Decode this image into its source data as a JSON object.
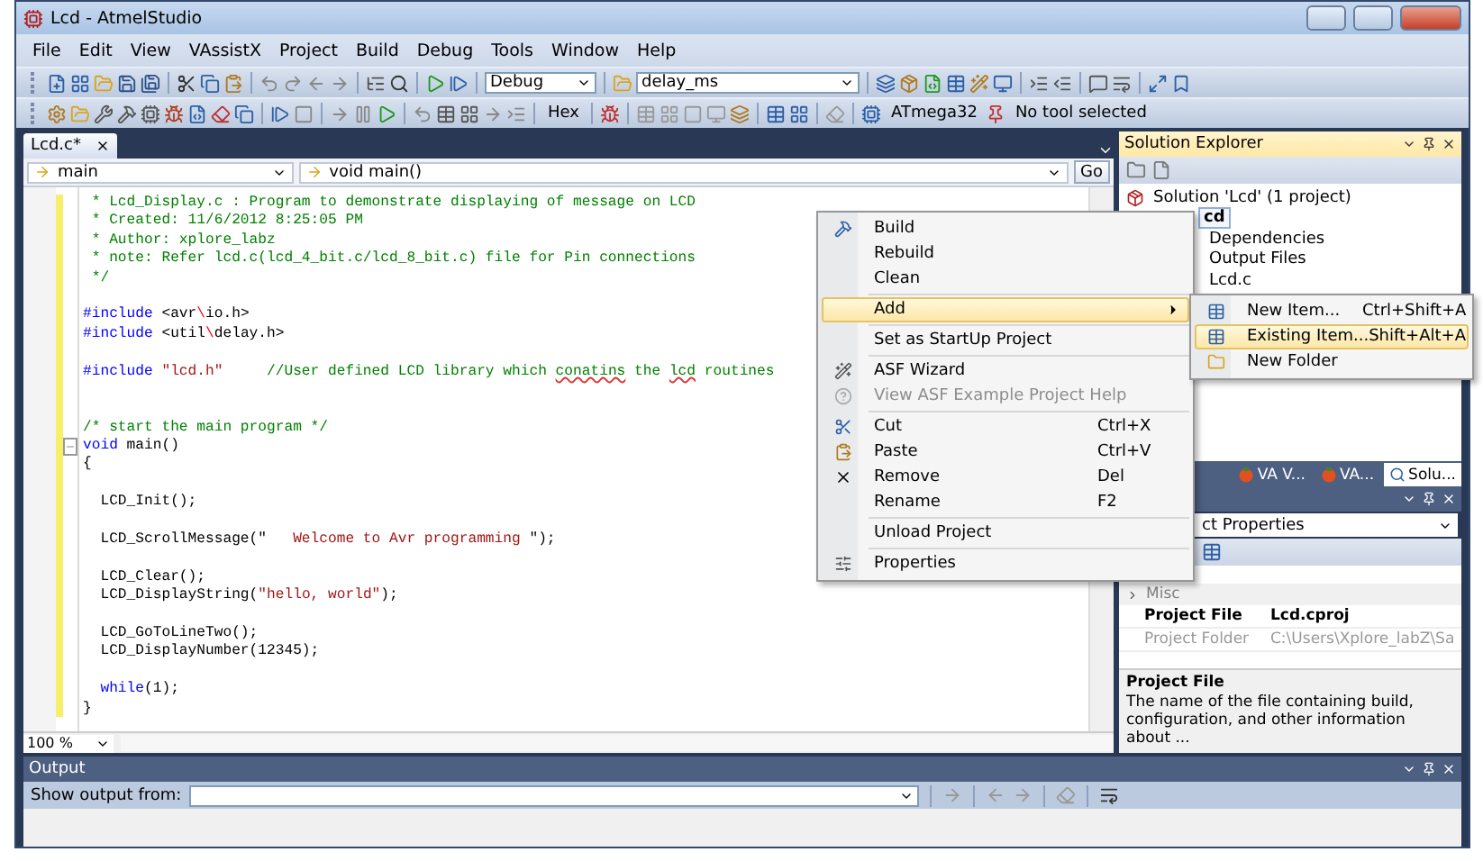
{
  "window": {
    "title": "Lcd - AtmelStudio"
  },
  "menu_bar": [
    "File",
    "Edit",
    "View",
    "VAssistX",
    "Project",
    "Build",
    "Debug",
    "Tools",
    "Window",
    "Help"
  ],
  "toolbar": {
    "configuration": "Debug",
    "function_search": "delay_ms",
    "hex_label": "Hex",
    "device": "ATmega32",
    "tool": "No tool selected"
  },
  "editor": {
    "tab": {
      "label": "Lcd.c*",
      "selected": true
    },
    "scope": "main",
    "member": "void main()",
    "go_button": "Go",
    "zoom": "100 %",
    "lines": [
      {
        "kind": "code",
        "tokens": [
          {
            "text": " * Lcd_Display.c : Program to demonstrate displaying of message on LCD",
            "kind": "comment"
          }
        ]
      },
      {
        "kind": "code",
        "tokens": [
          {
            "text": " * Created: 11/6/2012 8:25:05 PM",
            "kind": "comment"
          }
        ]
      },
      {
        "kind": "code",
        "tokens": [
          {
            "text": " * Author: xplore_labz",
            "kind": "comment"
          }
        ]
      },
      {
        "kind": "code",
        "tokens": [
          {
            "text": " * note: Refer lcd.c(lcd_4_bit.c/lcd_8_bit.c) file for Pin connections",
            "kind": "comment"
          }
        ]
      },
      {
        "kind": "code",
        "tokens": [
          {
            "text": " */",
            "kind": "comment"
          }
        ]
      },
      {
        "kind": "blank"
      },
      {
        "kind": "code",
        "tokens": [
          {
            "text": "#include",
            "kind": "keyword"
          },
          {
            "text": " <avr",
            "kind": "plain"
          },
          {
            "text": "\\",
            "kind": "escape"
          },
          {
            "text": "io.h>",
            "kind": "plain"
          }
        ]
      },
      {
        "kind": "code",
        "tokens": [
          {
            "text": "#include",
            "kind": "keyword"
          },
          {
            "text": " <util",
            "kind": "plain"
          },
          {
            "text": "\\",
            "kind": "escape"
          },
          {
            "text": "delay.h>",
            "kind": "plain"
          }
        ]
      },
      {
        "kind": "blank"
      },
      {
        "kind": "code",
        "tokens": [
          {
            "text": "#include",
            "kind": "keyword"
          },
          {
            "text": " \"lcd.h\"",
            "kind": "string"
          },
          {
            "text": "     //User defined LCD library which ",
            "kind": "comment"
          },
          {
            "text": "conatins",
            "kind": "misspelled"
          },
          {
            "text": " the ",
            "kind": "comment"
          },
          {
            "text": "lcd",
            "kind": "misspelled"
          },
          {
            "text": " routines",
            "kind": "comment"
          }
        ]
      },
      {
        "kind": "blank"
      },
      {
        "kind": "blank"
      },
      {
        "kind": "code",
        "tokens": [
          {
            "text": "/* start the main program */",
            "kind": "comment"
          }
        ]
      },
      {
        "kind": "code",
        "fold": true,
        "tokens": [
          {
            "text": "void",
            "kind": "keyword"
          },
          {
            "text": " main()",
            "kind": "plain"
          }
        ]
      },
      {
        "kind": "code",
        "tokens": [
          {
            "text": "{",
            "kind": "plain"
          }
        ]
      },
      {
        "kind": "blank"
      },
      {
        "kind": "code",
        "tokens": [
          {
            "text": "  LCD_Init();",
            "kind": "plain"
          }
        ]
      },
      {
        "kind": "blank"
      },
      {
        "kind": "code",
        "tokens": [
          {
            "text": "  LCD_ScrollMessage(\"",
            "kind": "plain"
          },
          {
            "text": "   Welcome to Avr programming ",
            "kind": "string"
          },
          {
            "text": "\");",
            "kind": "plain"
          }
        ]
      },
      {
        "kind": "blank"
      },
      {
        "kind": "code",
        "tokens": [
          {
            "text": "  LCD_Clear();",
            "kind": "plain"
          }
        ]
      },
      {
        "kind": "code",
        "tokens": [
          {
            "text": "  LCD_DisplayString(",
            "kind": "plain"
          },
          {
            "text": "\"hello, world\"",
            "kind": "string"
          },
          {
            "text": ");",
            "kind": "plain"
          }
        ]
      },
      {
        "kind": "blank"
      },
      {
        "kind": "code",
        "tokens": [
          {
            "text": "  LCD_GoToLineTwo();",
            "kind": "plain"
          }
        ]
      },
      {
        "kind": "code",
        "tokens": [
          {
            "text": "  LCD_DisplayNumber(12345);",
            "kind": "plain"
          }
        ]
      },
      {
        "kind": "blank"
      },
      {
        "kind": "code",
        "tokens": [
          {
            "text": "  while",
            "kind": "keyword"
          },
          {
            "text": "(1);",
            "kind": "plain"
          }
        ]
      },
      {
        "kind": "code",
        "tokens": [
          {
            "text": "}",
            "kind": "plain"
          }
        ]
      }
    ]
  },
  "context_menu": {
    "items": [
      {
        "kind": "item",
        "label": "Build",
        "selected": false,
        "disabled": false
      },
      {
        "kind": "item",
        "label": "Rebuild",
        "selected": false,
        "disabled": false
      },
      {
        "kind": "item",
        "label": "Clean",
        "selected": false,
        "disabled": false
      },
      {
        "kind": "separator"
      },
      {
        "kind": "submenu",
        "label": "Add",
        "selected": true,
        "disabled": false
      },
      {
        "kind": "separator"
      },
      {
        "kind": "item",
        "label": "Set as StartUp Project",
        "selected": false,
        "disabled": false
      },
      {
        "kind": "separator"
      },
      {
        "kind": "item",
        "label": "ASF Wizard",
        "selected": false,
        "disabled": false
      },
      {
        "kind": "item",
        "label": "View ASF Example Project Help",
        "selected": false,
        "disabled": true
      },
      {
        "kind": "separator"
      },
      {
        "kind": "item",
        "label": "Cut",
        "shortcut": "Ctrl+X",
        "selected": false,
        "disabled": false
      },
      {
        "kind": "item",
        "label": "Paste",
        "shortcut": "Ctrl+V",
        "selected": false,
        "disabled": false
      },
      {
        "kind": "item",
        "label": "Remove",
        "shortcut": "Del",
        "selected": false,
        "disabled": false
      },
      {
        "kind": "item",
        "label": "Rename",
        "shortcut": "F2",
        "selected": false,
        "disabled": false
      },
      {
        "kind": "separator"
      },
      {
        "kind": "item",
        "label": "Unload Project",
        "selected": false,
        "disabled": false
      },
      {
        "kind": "separator"
      },
      {
        "kind": "item",
        "label": "Properties",
        "selected": false,
        "disabled": false
      }
    ]
  },
  "submenu": {
    "items": [
      {
        "label": "New Item...",
        "shortcut": "Ctrl+Shift+A",
        "selected": false
      },
      {
        "label": "Existing Item...",
        "shortcut": "Shift+Alt+A",
        "selected": true
      },
      {
        "label": "New Folder",
        "selected": false
      }
    ]
  },
  "solution_explorer": {
    "title": "Solution Explorer",
    "tree": {
      "label": "Solution 'Lcd' (1 project)",
      "selected": false,
      "children": [
        {
          "label": "cd",
          "selected": true,
          "children": [
            {
              "label": "Dependencies",
              "selected": false
            },
            {
              "label": "Output Files",
              "selected": false
            },
            {
              "label": "Lcd.c",
              "selected": false
            }
          ]
        }
      ]
    },
    "tabs": [
      {
        "label": "VA V...",
        "selected": false
      },
      {
        "label": "VA...",
        "selected": false
      },
      {
        "label": "Solu...",
        "selected": true
      }
    ]
  },
  "properties": {
    "object": "ct Properties",
    "category": "Misc",
    "rows": [
      {
        "name": "Project File",
        "value": "Lcd.cproj",
        "disabled": false
      },
      {
        "name": "Project Folder",
        "value": "C:\\Users\\Xplore_labZ\\Sa",
        "disabled": true
      }
    ],
    "description_title": "Project File",
    "description": "The name of the file containing build, configuration, and other information about ..."
  },
  "output": {
    "title": "Output",
    "show_output_label": "Show output from:"
  }
}
